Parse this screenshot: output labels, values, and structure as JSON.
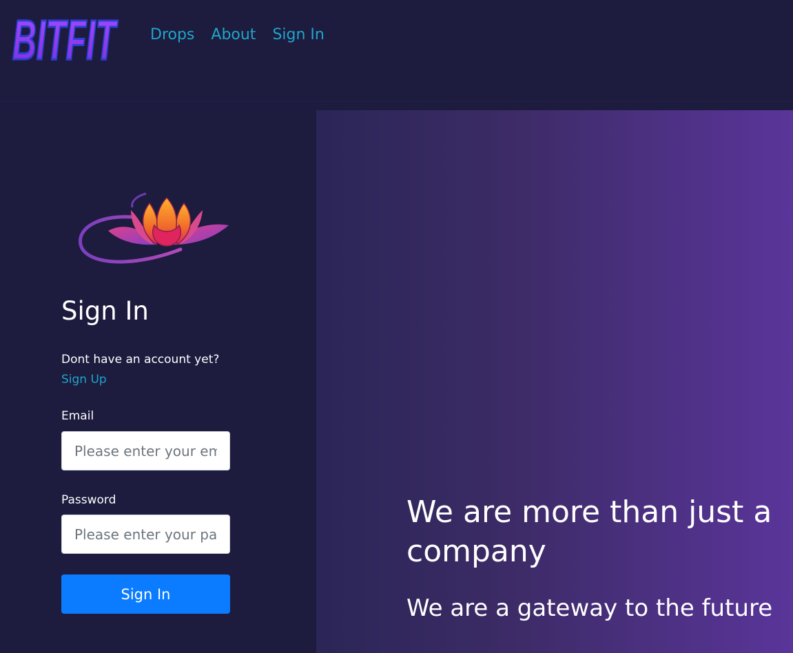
{
  "brand": {
    "name": "BITFIT"
  },
  "nav": {
    "items": [
      {
        "label": "Drops"
      },
      {
        "label": "About"
      },
      {
        "label": "Sign In"
      }
    ]
  },
  "signin": {
    "title": "Sign In",
    "prompt": "Dont have an account yet?",
    "signup_link": "Sign Up",
    "email": {
      "label": "Email",
      "placeholder": "Please enter your email"
    },
    "password": {
      "label": "Password",
      "placeholder": "Please enter your password"
    },
    "submit_label": "Sign In"
  },
  "hero": {
    "heading": "We are more than just a company",
    "subheading": "We are a gateway to the future"
  },
  "colors": {
    "background": "#1d1b3e",
    "accent_link": "#1ea7c9",
    "primary_button": "#0b7bff",
    "hero_gradient_start": "#2b2657",
    "hero_gradient_end": "#5a359a"
  }
}
